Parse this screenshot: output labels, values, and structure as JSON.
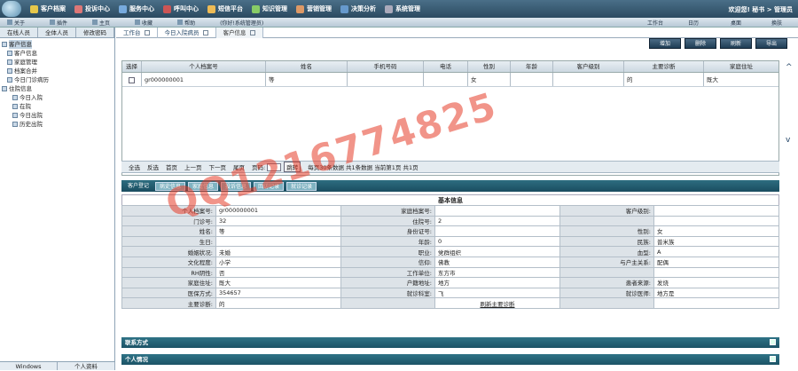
{
  "topnav": {
    "items": [
      "客户档案",
      "投诉中心",
      "服务中心",
      "呼叫中心",
      "短信平台",
      "知识管理",
      "营销管理",
      "决策分析",
      "系统管理"
    ],
    "welcome": "欢迎您! 秘书 > 管理员"
  },
  "toolbar": {
    "left": [
      "关于",
      "插件",
      "主页",
      "收藏",
      "帮助",
      "(你好!系统管理员)"
    ],
    "right": [
      "工作台",
      "日历",
      "桌面",
      "换肤"
    ]
  },
  "sidebar": {
    "tabs": [
      "在线人员",
      "全体人员",
      "修改密码"
    ],
    "tree": [
      {
        "label": "客户信息",
        "level": 0,
        "selected": true
      },
      {
        "label": "客户信息",
        "level": 1
      },
      {
        "label": "家庭管理",
        "level": 1
      },
      {
        "label": "档案合并",
        "level": 1
      },
      {
        "label": "今日门诊病历",
        "level": 1
      },
      {
        "label": "住院信息",
        "level": 0
      },
      {
        "label": "今日入院",
        "level": 2
      },
      {
        "label": "在院",
        "level": 2
      },
      {
        "label": "今日出院",
        "level": 2
      },
      {
        "label": "历史出院",
        "level": 2
      }
    ],
    "bottom": [
      "Windows",
      "个人资料"
    ]
  },
  "tabs": [
    "工作台",
    "今日入院病员",
    "客户信息"
  ],
  "actions": [
    "增加",
    "删除",
    "刷新",
    "导出"
  ],
  "grid": {
    "columns": [
      "选择",
      "个人档案号",
      "姓名",
      "手机号码",
      "电话",
      "性别",
      "年龄",
      "客户级别",
      "主要诊断",
      "家庭住址"
    ],
    "rows": [
      [
        "",
        "gr000000001",
        "等",
        "",
        "",
        "女",
        "",
        "",
        "的",
        "既大"
      ]
    ]
  },
  "pager": {
    "items": [
      "全选",
      "反选",
      "首页",
      "上一页",
      "下一页",
      "尾页",
      "页码:"
    ],
    "go": "跳转",
    "info": "每页30条数据  共1条数据  当前第1页  共1页"
  },
  "subtabs": [
    "客户登记",
    "病史信息",
    "家庭信息",
    "投诉信息",
    "回访记录",
    "就诊记录"
  ],
  "info": {
    "title": "基本信息",
    "rows": [
      [
        "个人档案号:",
        "gr000000001",
        "家庭档案号:",
        "",
        "客户级别:",
        ""
      ],
      [
        "门诊号:",
        "32",
        "住院号:",
        "2",
        "",
        ""
      ],
      [
        "姓名:",
        "等",
        "身份证号:",
        "",
        "性别:",
        "女"
      ],
      [
        "生日:",
        "",
        "年龄:",
        "0",
        "民族:",
        "普米族"
      ],
      [
        "婚姻状况:",
        "未婚",
        "职业:",
        "党群组织",
        "血型:",
        "A"
      ],
      [
        "文化程度:",
        "小学",
        "信仰:",
        "佛教",
        "与户主关系:",
        "配偶"
      ],
      [
        "RH阴性:",
        "否",
        "工作单位:",
        "东方市",
        "",
        ""
      ],
      [
        "家庭住址:",
        "既大",
        "户籍地址:",
        "地方",
        "患者来源:",
        "发烧"
      ],
      [
        "医保方式:",
        "354657",
        "就诊科室:",
        "飞",
        "就诊医师:",
        "地方是"
      ],
      [
        "主要诊断:",
        "的",
        "",
        "刷新主要诊断",
        "",
        ""
      ]
    ]
  },
  "sections": [
    "联系方式",
    "个人情况"
  ],
  "watermark": "QQ1216774825"
}
